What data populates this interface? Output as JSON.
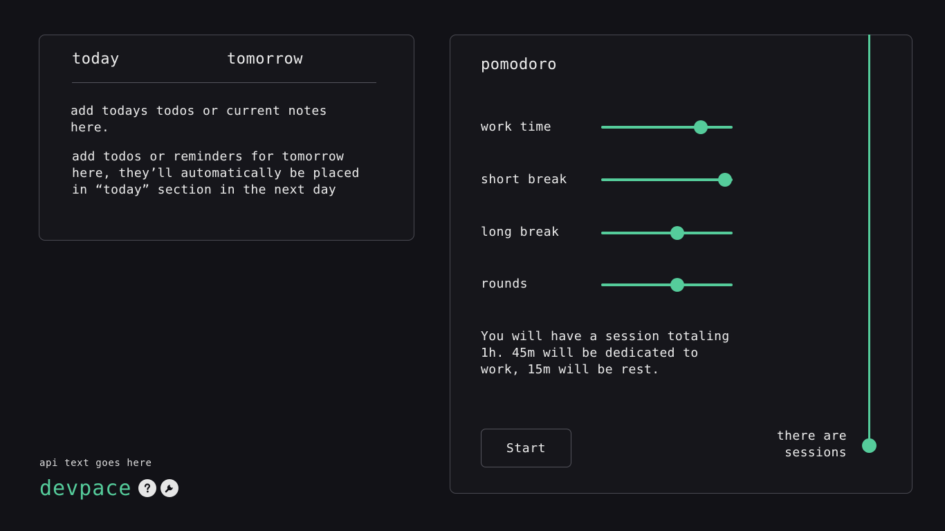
{
  "tabs": {
    "today_label": "today",
    "tomorrow_label": "tomorrow"
  },
  "notes": {
    "today_text": "add todays todos or current notes here.",
    "tomorrow_text": "add todos or reminders for tomorrow here, they’ll automatically be placed in “today” section in the next day"
  },
  "pomodoro": {
    "title": "pomodoro",
    "sliders": [
      {
        "label": "work time",
        "fraction": 0.76
      },
      {
        "label": "short break",
        "fraction": 0.94
      },
      {
        "label": "long break",
        "fraction": 0.58
      },
      {
        "label": "rounds",
        "fraction": 0.58
      }
    ],
    "summary": "You will have a session totaling 1h. 45m will be dedicated to work, 15m will be rest.",
    "start_label": "Start",
    "sessions_text": "there are sessions"
  },
  "footer": {
    "api_text": "api text goes here",
    "brand": "devpace",
    "icons": [
      "help-icon",
      "wrench-icon"
    ]
  },
  "colors": {
    "accent": "#55cc9b",
    "background": "#121217",
    "panel": "#16161b",
    "text": "#ececec"
  }
}
